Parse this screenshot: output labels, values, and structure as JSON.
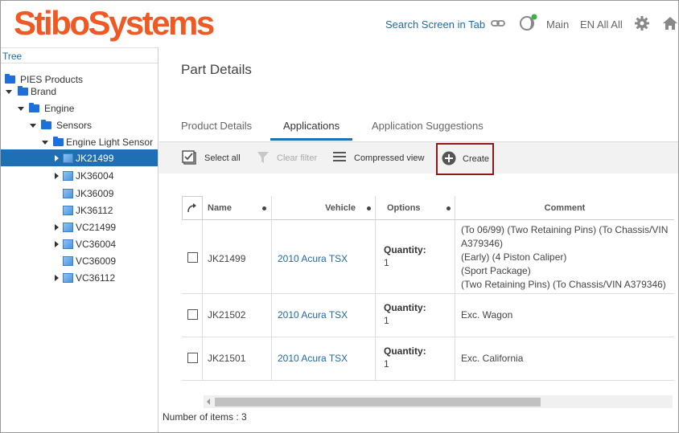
{
  "header": {
    "logo_text": "StiboSystems",
    "search_link": "Search Screen in Tab",
    "context": "Main",
    "locale": "EN All All",
    "icons": [
      "link-icon",
      "theme-icon",
      "gear-icon",
      "home-icon"
    ],
    "brand_color": "#ef5a24"
  },
  "tree": {
    "tab_label": "Tree",
    "nodes": [
      {
        "label": "PIES Products",
        "type": "folder",
        "caret": "none"
      },
      {
        "label": "Brand",
        "type": "folder",
        "caret": "down"
      },
      {
        "label": "Engine",
        "type": "folder",
        "caret": "down"
      },
      {
        "label": "Sensors",
        "type": "folder",
        "caret": "down"
      },
      {
        "label": "Engine Light Sensor",
        "type": "folder",
        "caret": "down"
      },
      {
        "label": "JK21499",
        "type": "product",
        "caret": "right",
        "selected": true
      },
      {
        "label": "JK36004",
        "type": "product",
        "caret": "right"
      },
      {
        "label": "JK36009",
        "type": "product",
        "caret": "none"
      },
      {
        "label": "JK36112",
        "type": "product",
        "caret": "none"
      },
      {
        "label": "VC21499",
        "type": "product",
        "caret": "right"
      },
      {
        "label": "VC36004",
        "type": "product",
        "caret": "right"
      },
      {
        "label": "VC36009",
        "type": "product",
        "caret": "none"
      },
      {
        "label": "VC36112",
        "type": "product",
        "caret": "right"
      }
    ]
  },
  "main": {
    "title": "Part Details",
    "tabs": [
      {
        "label": "Product Details",
        "active": false
      },
      {
        "label": "Applications",
        "active": true
      },
      {
        "label": "Application Suggestions",
        "active": false
      }
    ],
    "toolbar": {
      "select_all": "Select all",
      "clear_filter": "Clear filter",
      "compressed_view": "Compressed view",
      "create": "Create"
    },
    "table": {
      "columns": [
        "Name",
        "Vehicle",
        "Options",
        "Comment"
      ],
      "rows": [
        {
          "name": "JK21499",
          "vehicle": "2010 Acura TSX",
          "qty_label": "Quantity:",
          "qty": "1",
          "comment": [
            "(To 06/99) (Two Retaining Pins) (To Chassis/VIN",
            "A379346)",
            "(Early) (4 Piston Caliper)",
            "(Sport Package)",
            "(Two Retaining Pins) (To Chassis/VIN A379346)"
          ]
        },
        {
          "name": "JK21502",
          "vehicle": "2010 Acura TSX",
          "qty_label": "Quantity:",
          "qty": "1",
          "comment": [
            "Exc. Wagon"
          ]
        },
        {
          "name": "JK21501",
          "vehicle": "2010 Acura TSX",
          "qty_label": "Quantity:",
          "qty": "1",
          "comment": [
            "Exc. California"
          ]
        }
      ]
    },
    "count_text": "Number of items : 3"
  }
}
